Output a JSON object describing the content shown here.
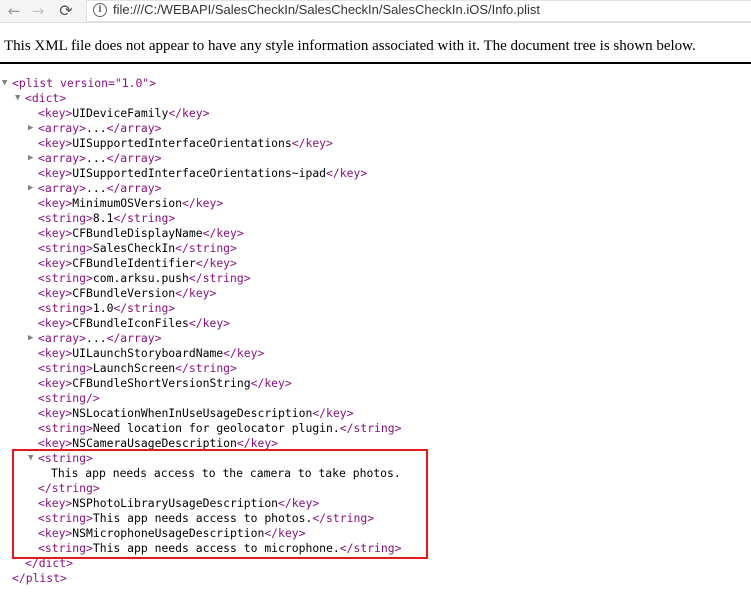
{
  "browser": {
    "url": "file:///C:/WEBAPI/SalesCheckIn/SalesCheckIn/SalesCheckIn.iOS/Info.plist",
    "nav": {
      "back": "←",
      "forward": "→",
      "reload": "⟳"
    }
  },
  "notice": "This XML file does not appear to have any style information associated with it. The document tree is shown below.",
  "colors": {
    "tag": "#881280",
    "text": "#000000",
    "highlight": "#e8171c",
    "toggle": "#808080"
  },
  "tree": {
    "plist_open": "<plist version=\"1.0\">",
    "dict_open": "<dict>",
    "entries": [
      {
        "tag": "key",
        "value": "UIDeviceFamily"
      },
      {
        "tag": "array",
        "value": "...",
        "collapsed": true
      },
      {
        "tag": "key",
        "value": "UISupportedInterfaceOrientations"
      },
      {
        "tag": "array",
        "value": "...",
        "collapsed": true
      },
      {
        "tag": "key",
        "value": "UISupportedInterfaceOrientations~ipad"
      },
      {
        "tag": "array",
        "value": "...",
        "collapsed": true
      },
      {
        "tag": "key",
        "value": "MinimumOSVersion"
      },
      {
        "tag": "string",
        "value": "8.1"
      },
      {
        "tag": "key",
        "value": "CFBundleDisplayName"
      },
      {
        "tag": "string",
        "value": "SalesCheckIn"
      },
      {
        "tag": "key",
        "value": "CFBundleIdentifier"
      },
      {
        "tag": "string",
        "value": "com.arksu.push"
      },
      {
        "tag": "key",
        "value": "CFBundleVersion"
      },
      {
        "tag": "string",
        "value": "1.0"
      },
      {
        "tag": "key",
        "value": "CFBundleIconFiles"
      },
      {
        "tag": "array",
        "value": "...",
        "collapsed": true
      },
      {
        "tag": "key",
        "value": "UILaunchStoryboardName"
      },
      {
        "tag": "string",
        "value": "LaunchScreen"
      },
      {
        "tag": "key",
        "value": "CFBundleShortVersionString"
      },
      {
        "tag": "string",
        "value": "",
        "self_closing": true
      },
      {
        "tag": "key",
        "value": "NSLocationWhenInUseUsageDescription"
      },
      {
        "tag": "string",
        "value": "Need location for geolocator plugin."
      },
      {
        "tag": "key",
        "value": "NSCameraUsageDescription"
      }
    ],
    "expanded_string": {
      "open": "<string>",
      "value": "This app needs access to the camera to take photos.",
      "close": "</string>"
    },
    "tail_entries": [
      {
        "tag": "key",
        "value": "NSPhotoLibraryUsageDescription"
      },
      {
        "tag": "string",
        "value": "This app needs access to photos."
      },
      {
        "tag": "key",
        "value": "NSMicrophoneUsageDescription"
      },
      {
        "tag": "string",
        "value": "This app needs access to microphone."
      }
    ],
    "dict_close": "</dict>",
    "plist_close": "</plist>"
  }
}
